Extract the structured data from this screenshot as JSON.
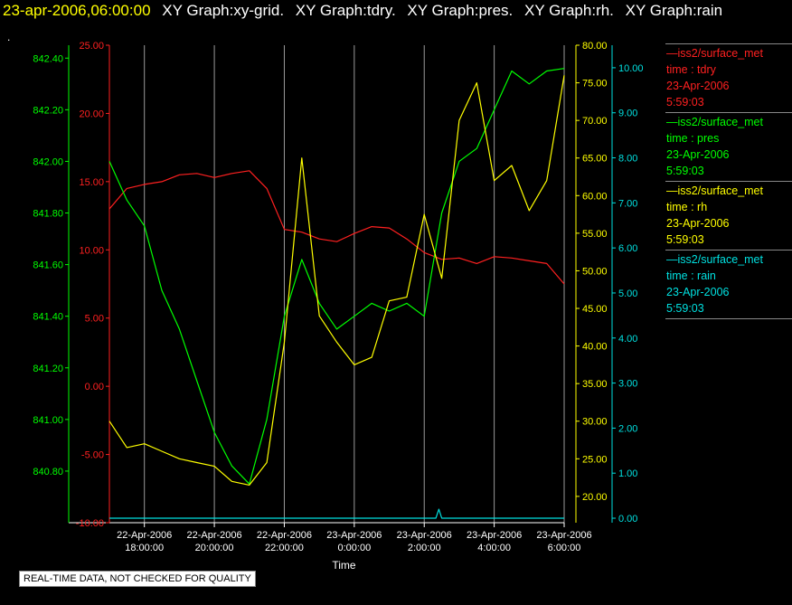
{
  "header": {
    "timestamp": "23-apr-2006,06:00:00",
    "graphs": [
      "XY Graph:xy-grid.",
      "XY Graph:tdry.",
      "XY Graph:pres.",
      "XY Graph:rh.",
      "XY Graph:rain"
    ],
    "dot": "."
  },
  "legend": [
    {
      "name": "—iss2/surface_met",
      "line2": "time : tdry",
      "line3": "23-Apr-2006",
      "line4": "5:59:03",
      "color": "#ff2020"
    },
    {
      "name": "—iss2/surface_met",
      "line2": "time : pres",
      "line3": "23-Apr-2006",
      "line4": "5:59:03",
      "color": "#00ff00"
    },
    {
      "name": "—iss2/surface_met",
      "line2": "time : rh",
      "line3": "23-Apr-2006",
      "line4": "5:59:03",
      "color": "#ffff00"
    },
    {
      "name": "—iss2/surface_met",
      "line2": "time : rain",
      "line3": "23-Apr-2006",
      "line4": "5:59:03",
      "color": "#00e0e0"
    }
  ],
  "footer": "REAL-TIME DATA, NOT CHECKED FOR QUALITY",
  "chart_data": {
    "type": "line",
    "xlabel": "Time",
    "x_ticks": [
      [
        "22-Apr-2006",
        "18:00:00"
      ],
      [
        "22-Apr-2006",
        "20:00:00"
      ],
      [
        "22-Apr-2006",
        "22:00:00"
      ],
      [
        "23-Apr-2006",
        "0:00:00"
      ],
      [
        "23-Apr-2006",
        "2:00:00"
      ],
      [
        "23-Apr-2006",
        "4:00:00"
      ],
      [
        "23-Apr-2006",
        "6:00:00"
      ]
    ],
    "xlim": [
      "2006-04-22T17:00",
      "2006-04-23T06:00"
    ],
    "grid": "vertical",
    "axes": [
      {
        "id": "tdry",
        "side": "left",
        "color": "#ff2020",
        "ylim": [
          -10,
          25
        ],
        "ticks": [
          "-10.00",
          "-5.00",
          "0.00",
          "5.00",
          "10.00",
          "15.00",
          "20.00",
          "25.00"
        ]
      },
      {
        "id": "pres",
        "side": "left",
        "color": "#00ff00",
        "ylim": [
          840.6,
          842.45
        ],
        "ticks": [
          "840.80",
          "841.00",
          "841.20",
          "841.40",
          "841.60",
          "841.80",
          "842.00",
          "842.20",
          "842.40"
        ]
      },
      {
        "id": "rh",
        "side": "right",
        "color": "#ffff00",
        "ylim": [
          16.5,
          80
        ],
        "ticks": [
          "20.00",
          "25.00",
          "30.00",
          "35.00",
          "40.00",
          "45.00",
          "50.00",
          "55.00",
          "60.00",
          "65.00",
          "70.00",
          "75.00",
          "80.00"
        ]
      },
      {
        "id": "rain",
        "side": "right",
        "color": "#00e0e0",
        "ylim": [
          -0.1,
          10.5
        ],
        "ticks": [
          "0.00",
          "1.00",
          "2.00",
          "3.00",
          "4.00",
          "5.00",
          "6.00",
          "7.00",
          "8.00",
          "9.00",
          "10.00"
        ]
      }
    ],
    "series": [
      {
        "name": "tdry",
        "axis": "tdry",
        "color": "#ff2020",
        "x": [
          "2006-04-22T17:00",
          "2006-04-22T17:30",
          "2006-04-22T18:00",
          "2006-04-22T18:30",
          "2006-04-22T19:00",
          "2006-04-22T19:30",
          "2006-04-22T20:00",
          "2006-04-22T20:30",
          "2006-04-22T21:00",
          "2006-04-22T21:30",
          "2006-04-22T22:00",
          "2006-04-22T22:30",
          "2006-04-22T23:00",
          "2006-04-22T23:30",
          "2006-04-23T00:00",
          "2006-04-23T00:30",
          "2006-04-23T01:00",
          "2006-04-23T01:30",
          "2006-04-23T02:00",
          "2006-04-23T02:30",
          "2006-04-23T03:00",
          "2006-04-23T03:30",
          "2006-04-23T04:00",
          "2006-04-23T04:30",
          "2006-04-23T05:00",
          "2006-04-23T05:30",
          "2006-04-23T06:00"
        ],
        "y": [
          13.0,
          14.5,
          14.8,
          15.0,
          15.5,
          15.6,
          15.3,
          15.6,
          15.8,
          14.5,
          11.5,
          11.3,
          10.8,
          10.6,
          11.2,
          11.7,
          11.6,
          10.8,
          9.8,
          9.3,
          9.4,
          9.0,
          9.5,
          9.4,
          9.2,
          9.0,
          7.5
        ]
      },
      {
        "name": "pres",
        "axis": "pres",
        "color": "#00ff00",
        "x": [
          "2006-04-22T17:00",
          "2006-04-22T17:30",
          "2006-04-22T18:00",
          "2006-04-22T18:30",
          "2006-04-22T19:00",
          "2006-04-22T19:30",
          "2006-04-22T20:00",
          "2006-04-22T20:30",
          "2006-04-22T21:00",
          "2006-04-22T21:30",
          "2006-04-22T22:00",
          "2006-04-22T22:30",
          "2006-04-22T23:00",
          "2006-04-22T23:30",
          "2006-04-23T00:00",
          "2006-04-23T00:30",
          "2006-04-23T01:00",
          "2006-04-23T01:30",
          "2006-04-23T02:00",
          "2006-04-23T02:30",
          "2006-04-23T03:00",
          "2006-04-23T03:30",
          "2006-04-23T04:00",
          "2006-04-23T04:30",
          "2006-04-23T05:00",
          "2006-04-23T05:30",
          "2006-04-23T06:00"
        ],
        "y": [
          842.0,
          841.85,
          841.75,
          841.5,
          841.35,
          841.15,
          840.95,
          840.82,
          840.75,
          841.0,
          841.4,
          841.62,
          841.45,
          841.35,
          841.4,
          841.45,
          841.42,
          841.45,
          841.4,
          841.8,
          842.0,
          842.05,
          842.2,
          842.35,
          842.3,
          842.35,
          842.36
        ]
      },
      {
        "name": "rh",
        "axis": "rh",
        "color": "#ffff00",
        "x": [
          "2006-04-22T17:00",
          "2006-04-22T17:30",
          "2006-04-22T18:00",
          "2006-04-22T18:30",
          "2006-04-22T19:00",
          "2006-04-22T19:30",
          "2006-04-22T20:00",
          "2006-04-22T20:30",
          "2006-04-22T21:00",
          "2006-04-22T21:30",
          "2006-04-22T22:00",
          "2006-04-22T22:30",
          "2006-04-22T23:00",
          "2006-04-22T23:30",
          "2006-04-23T00:00",
          "2006-04-23T00:30",
          "2006-04-23T01:00",
          "2006-04-23T01:30",
          "2006-04-23T02:00",
          "2006-04-23T02:30",
          "2006-04-23T03:00",
          "2006-04-23T03:30",
          "2006-04-23T04:00",
          "2006-04-23T04:30",
          "2006-04-23T05:00",
          "2006-04-23T05:30",
          "2006-04-23T06:00"
        ],
        "y": [
          30.0,
          26.5,
          27.0,
          26.0,
          25.0,
          24.5,
          24.0,
          22.0,
          21.5,
          24.5,
          40.5,
          65.0,
          44.0,
          40.5,
          37.5,
          38.5,
          46.0,
          46.5,
          57.5,
          49.0,
          70.0,
          75.0,
          62.0,
          64.0,
          58.0,
          62.0,
          76.0
        ]
      },
      {
        "name": "rain",
        "axis": "rain",
        "color": "#00e0e0",
        "x": [
          "2006-04-22T17:00",
          "2006-04-23T02:20",
          "2006-04-23T02:25",
          "2006-04-23T02:30",
          "2006-04-23T02:35",
          "2006-04-23T06:00"
        ],
        "y": [
          0.0,
          0.0,
          0.2,
          0.0,
          0.0,
          0.0
        ]
      }
    ]
  }
}
